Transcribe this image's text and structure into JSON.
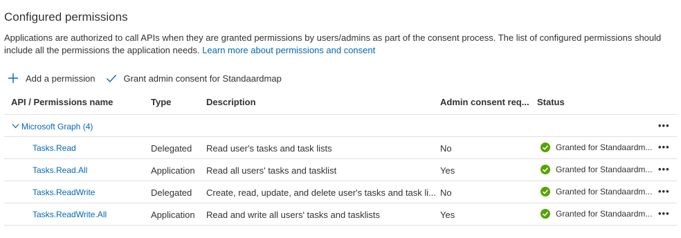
{
  "section_title": "Configured permissions",
  "description": {
    "text": "Applications are authorized to call APIs when they are granted permissions by users/admins as part of the consent process. The list of configured permissions should include all the permissions the application needs.",
    "link": "Learn more about permissions and consent"
  },
  "toolbar": {
    "add_label": "Add a permission",
    "grant_label": "Grant admin consent for Standaardmap"
  },
  "table": {
    "headers": {
      "api": "API / Permissions name",
      "type": "Type",
      "description": "Description",
      "admin": "Admin consent req...",
      "status": "Status"
    },
    "group": {
      "label": "Microsoft Graph (4)"
    },
    "rows": [
      {
        "name": "Tasks.Read",
        "type": "Delegated",
        "description": "Read user's tasks and task lists",
        "admin": "No",
        "status": "Granted for Standaardm..."
      },
      {
        "name": "Tasks.Read.All",
        "type": "Application",
        "description": "Read all users' tasks and tasklist",
        "admin": "Yes",
        "status": "Granted for Standaardm..."
      },
      {
        "name": "Tasks.ReadWrite",
        "type": "Delegated",
        "description": "Create, read, update, and delete user's tasks and task li...",
        "admin": "No",
        "status": "Granted for Standaardm..."
      },
      {
        "name": "Tasks.ReadWrite.All",
        "type": "Application",
        "description": "Read and write all users' tasks and tasklists",
        "admin": "Yes",
        "status": "Granted for Standaardm..."
      }
    ]
  },
  "more_glyph": "•••",
  "colors": {
    "link": "#0067b8",
    "granted": "#57a300",
    "divider": "#e1dfdd"
  }
}
